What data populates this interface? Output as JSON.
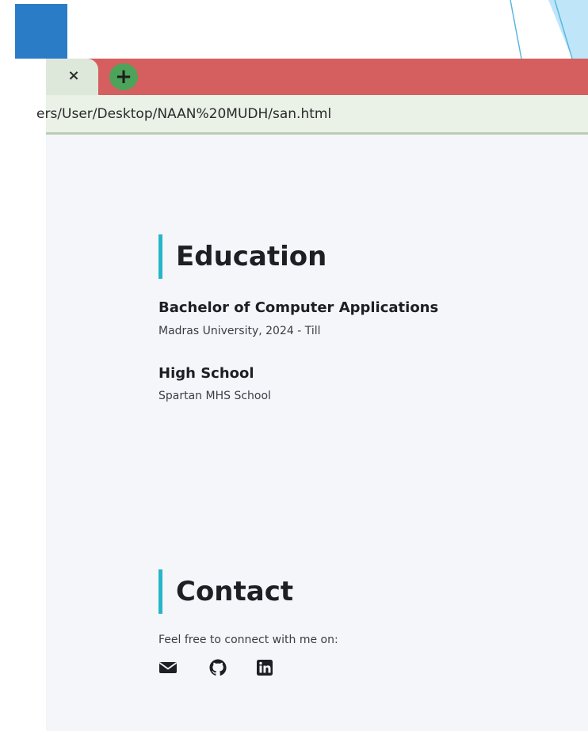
{
  "browser": {
    "tab_close_glyph": "×",
    "new_tab_glyph": "+",
    "url": "ers/User/Desktop/NAAN%20MUDH/san.html"
  },
  "education": {
    "heading": "Education",
    "items": [
      {
        "title": "Bachelor of Computer Applications",
        "detail": "Madras University, 2024 - Till"
      },
      {
        "title": "High School",
        "detail": "Spartan MHS School"
      }
    ]
  },
  "contact": {
    "heading": "Contact",
    "text": "Feel free to connect with me on:",
    "icons": [
      "envelope-icon",
      "github-icon",
      "linkedin-icon"
    ]
  },
  "colors": {
    "tab_bar": "#d55e5e",
    "accent": "#27b5c9",
    "slide_square": "#2b7cc7",
    "new_tab_button": "#4da35a"
  }
}
